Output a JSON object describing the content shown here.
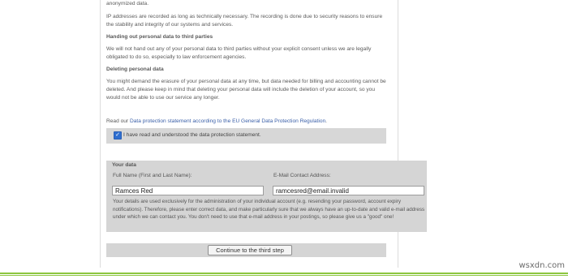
{
  "privacy": {
    "top_fragment": "anonymized data.",
    "ip_text": "IP addresses are recorded as long as technically necessary. The recording is done due to security reasons to ensure the stability and integrity of our systems and services.",
    "third_parties_heading": "Handing out personal data to third parties",
    "third_parties_text": "We will not hand out any of your personal data to third parties without your explicit consent unless we are legally obligated to do so, especially to law enforcement agencies.",
    "deleting_heading": "Deleting personal data",
    "deleting_text": "You might demand the erasure of your personal data at any time, but data needed for billing and accounting cannot be deleted. And please keep in mind that deleting your personal data will include the deletion of your account, so you would not be able to use our service any longer.",
    "read_prefix": "Read our",
    "read_link": "Data protection statement according to the EU General Data Protection Regulation",
    "read_suffix": "."
  },
  "consent": {
    "checked": true,
    "label": "I have read and understood the data protection statement."
  },
  "your_data": {
    "heading": "Your data",
    "name_label": "Full Name (First and Last Name):",
    "name_value": "Ramces Red",
    "email_label": "E-Mail Contact Address:",
    "email_value": "ramcesred@email.invalid",
    "note": "Your details are used exclusively for the administration of your individual account (e.g. resending your password, account expiry notifications). Therefore, please enter correct data, and make particularly sure that we always have an up-to-date and valid e-mail address under which we can contact you. You don't need to use that e-mail address in your postings, so please give us a \"good\" one!"
  },
  "continue_label": "Continue to the third step",
  "watermark": "wsxdn.com"
}
